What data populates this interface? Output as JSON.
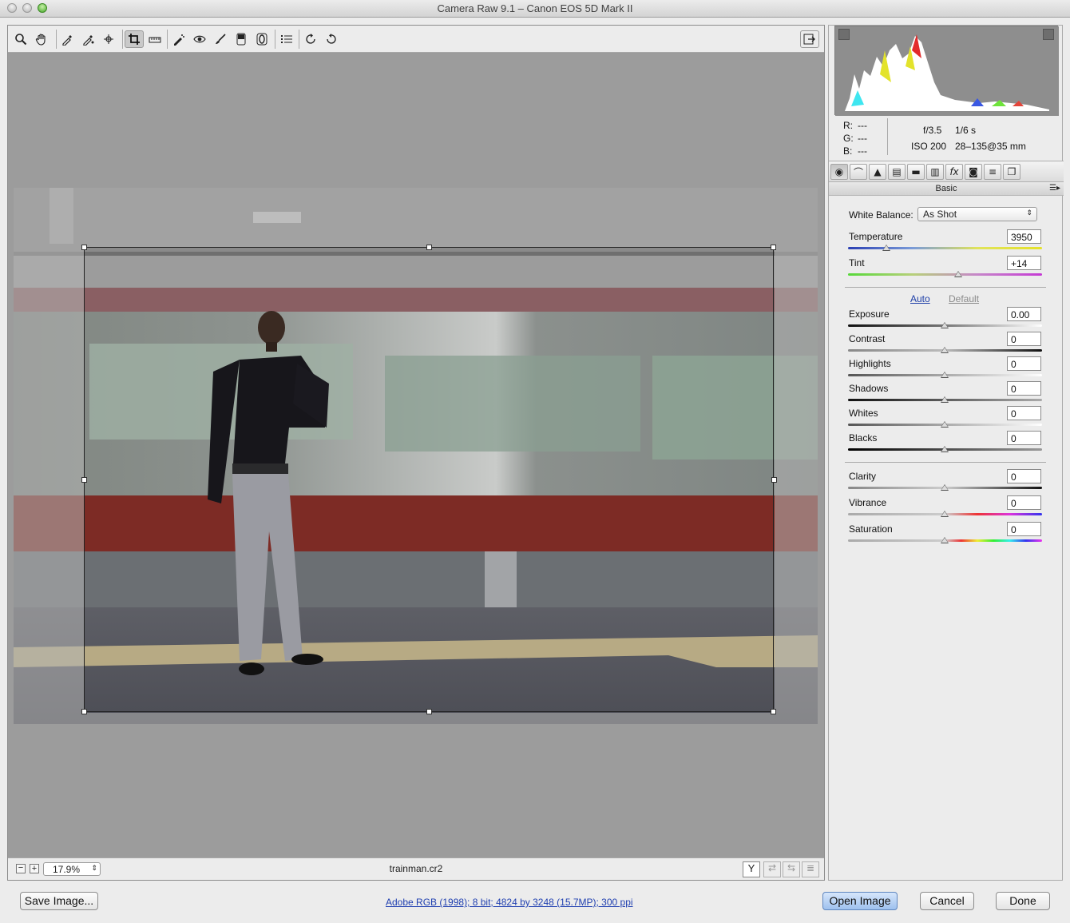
{
  "window": {
    "title": "Camera Raw 9.1  –  Canon EOS 5D Mark II"
  },
  "toolbar": {
    "tools": [
      "zoom-icon",
      "hand-icon",
      "white-balance-icon",
      "color-sampler-icon",
      "targeted-adjust-icon",
      "crop-icon",
      "straighten-icon",
      "spot-removal-icon",
      "red-eye-icon",
      "adjustment-brush-icon",
      "graduated-filter-icon",
      "radial-filter-icon",
      "preferences-icon",
      "rotate-ccw-icon",
      "rotate-cw-icon"
    ],
    "active_tool": "crop-icon",
    "fullscreen": "fullscreen-toggle-icon"
  },
  "status": {
    "zoom": "17.9%",
    "filename": "trainman.cr2"
  },
  "exif": {
    "r_label": "R:",
    "r_value": "---",
    "g_label": "G:",
    "g_value": "---",
    "b_label": "B:",
    "b_value": "---",
    "aperture": "f/3.5",
    "shutter": "1/6 s",
    "iso": "ISO 200",
    "lens": "28–135@35 mm"
  },
  "panel": {
    "title": "Basic",
    "white_balance_label": "White Balance:",
    "white_balance_value": "As Shot",
    "temperature_label": "Temperature",
    "temperature_value": "3950",
    "tint_label": "Tint",
    "tint_value": "+14",
    "auto_label": "Auto",
    "default_label": "Default",
    "exposure_label": "Exposure",
    "exposure_value": "0.00",
    "contrast_label": "Contrast",
    "contrast_value": "0",
    "highlights_label": "Highlights",
    "highlights_value": "0",
    "shadows_label": "Shadows",
    "shadows_value": "0",
    "whites_label": "Whites",
    "whites_value": "0",
    "blacks_label": "Blacks",
    "blacks_value": "0",
    "clarity_label": "Clarity",
    "clarity_value": "0",
    "vibrance_label": "Vibrance",
    "vibrance_value": "0",
    "saturation_label": "Saturation",
    "saturation_value": "0"
  },
  "footer": {
    "save_label": "Save Image...",
    "workflow_link": "Adobe RGB (1998); 8 bit; 4824 by 3248 (15.7MP); 300 ppi",
    "open_label": "Open Image",
    "cancel_label": "Cancel",
    "done_label": "Done"
  },
  "colors": {
    "accent": "#9ec1ee",
    "link": "#1f3fb0",
    "train_stripe": "#8a1f17"
  }
}
